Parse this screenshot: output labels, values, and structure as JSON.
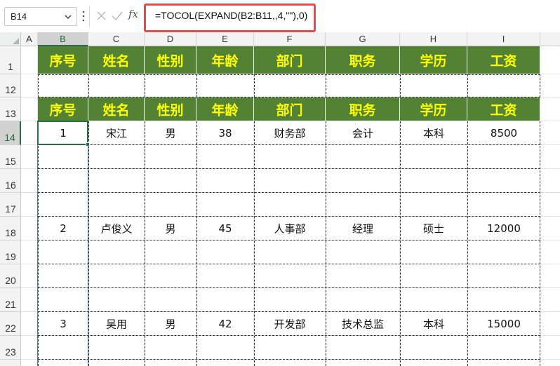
{
  "formula_bar": {
    "name_box": "B14",
    "fx_label": "fx",
    "formula": "=TOCOL(EXPAND(B2:B11,,4,\"\"),0)"
  },
  "columns": [
    "A",
    "B",
    "C",
    "D",
    "E",
    "F",
    "G",
    "H",
    "I"
  ],
  "selected_column": "B",
  "rows": [
    "1",
    "12",
    "13",
    "14",
    "15",
    "16",
    "17",
    "18",
    "19",
    "20",
    "21",
    "22",
    "23"
  ],
  "selected_row": "14",
  "table_header": [
    "序号",
    "姓名",
    "性别",
    "年龄",
    "部门",
    "职务",
    "学历",
    "工资"
  ],
  "records": [
    {
      "row": "14",
      "cells": [
        "1",
        "宋江",
        "男",
        "38",
        "财务部",
        "会计",
        "本科",
        "8500"
      ]
    },
    {
      "row": "18",
      "cells": [
        "2",
        "卢俊义",
        "男",
        "45",
        "人事部",
        "经理",
        "硕士",
        "12000"
      ]
    },
    {
      "row": "22",
      "cells": [
        "3",
        "吴用",
        "男",
        "42",
        "开发部",
        "技术总监",
        "本科",
        "15000"
      ]
    }
  ],
  "colors": {
    "header_fill": "#548235",
    "header_text": "#ffff00",
    "highlight_box": "#e44b4b",
    "selection": "#217346"
  }
}
